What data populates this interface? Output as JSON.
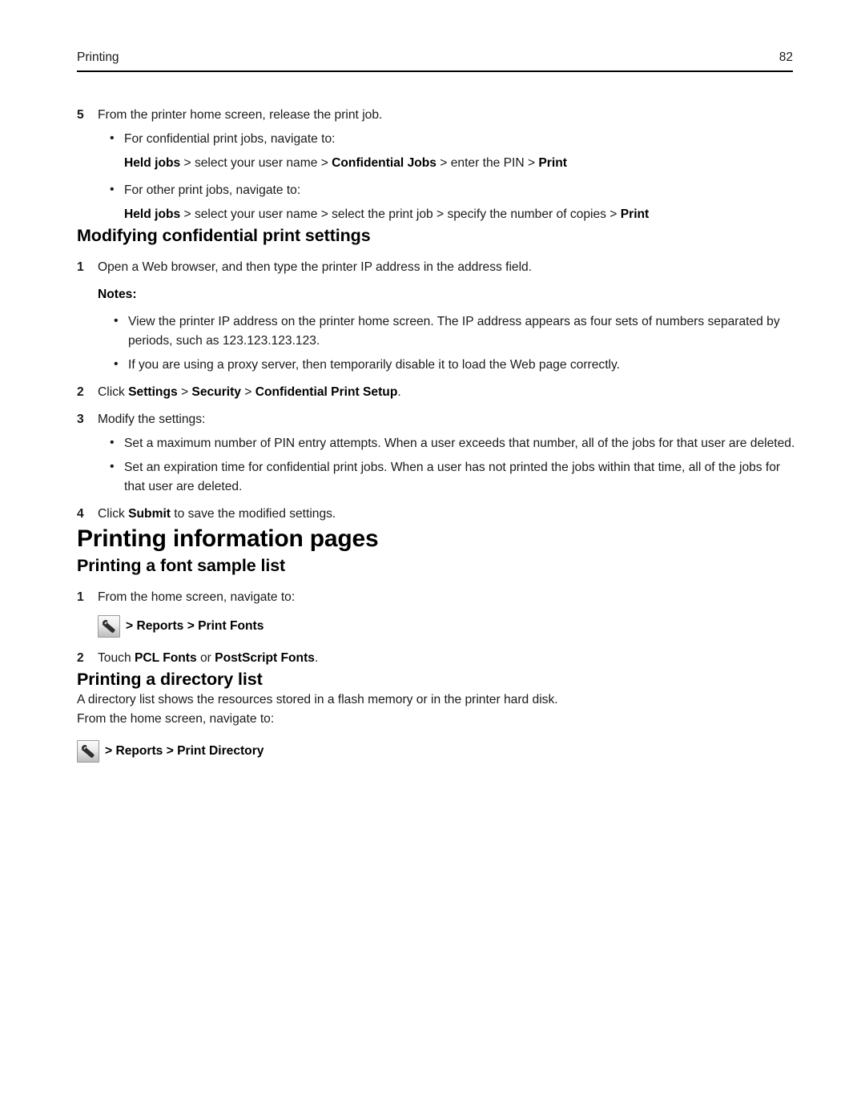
{
  "header": {
    "running_title": "Printing",
    "page_number": "82"
  },
  "step5": {
    "num": "5",
    "text": "From the printer home screen, release the print job.",
    "bullets": [
      {
        "lead": "For confidential print jobs, navigate to:",
        "path": [
          {
            "t": "Held jobs",
            "b": true
          },
          {
            "t": " > select your user name > ",
            "b": false
          },
          {
            "t": "Confidential Jobs",
            "b": true
          },
          {
            "t": " > enter the PIN > ",
            "b": false
          },
          {
            "t": "Print",
            "b": true
          }
        ]
      },
      {
        "lead": "For other print jobs, navigate to:",
        "path": [
          {
            "t": "Held jobs",
            "b": true
          },
          {
            "t": " > select your user name > select the print job > specify the number of copies > ",
            "b": false
          },
          {
            "t": "Print",
            "b": true
          }
        ]
      }
    ]
  },
  "section_modify": {
    "heading": "Modifying confidential print settings",
    "step1": {
      "num": "1",
      "text": "Open a Web browser, and then type the printer IP address in the address field."
    },
    "notes_label": "Notes:",
    "notes": [
      "View the printer IP address on the printer home screen. The IP address appears as four sets of numbers separated by periods, such as 123.123.123.123.",
      "If you are using a proxy server, then temporarily disable it to load the Web page correctly."
    ],
    "step2": {
      "num": "2",
      "parts": [
        {
          "t": "Click ",
          "b": false
        },
        {
          "t": "Settings",
          "b": true
        },
        {
          "t": " > ",
          "b": false
        },
        {
          "t": "Security",
          "b": true
        },
        {
          "t": " > ",
          "b": false
        },
        {
          "t": "Confidential Print Setup",
          "b": true
        },
        {
          "t": ".",
          "b": false
        }
      ]
    },
    "step3": {
      "num": "3",
      "text": "Modify the settings:",
      "bullets": [
        "Set a maximum number of PIN entry attempts. When a user exceeds that number, all of the jobs for that user are deleted.",
        "Set an expiration time for confidential print jobs. When a user has not printed the jobs within that time, all of the jobs for that user are deleted."
      ]
    },
    "step4": {
      "num": "4",
      "parts": [
        {
          "t": "Click ",
          "b": false
        },
        {
          "t": "Submit",
          "b": true
        },
        {
          "t": " to save the modified settings.",
          "b": false
        }
      ]
    }
  },
  "section_info_pages": {
    "heading": "Printing information pages"
  },
  "section_font_sample": {
    "heading": "Printing a font sample list",
    "step1": {
      "num": "1",
      "text": "From the home screen, navigate to:"
    },
    "nav_icon": "wrench-icon",
    "nav_path": "> Reports > Print Fonts",
    "step2": {
      "num": "2",
      "parts": [
        {
          "t": "Touch ",
          "b": false
        },
        {
          "t": "PCL Fonts",
          "b": true
        },
        {
          "t": " or ",
          "b": false
        },
        {
          "t": "PostScript Fonts",
          "b": true
        },
        {
          "t": ".",
          "b": false
        }
      ]
    }
  },
  "section_directory": {
    "heading": "Printing a directory list",
    "intro": "A directory list shows the resources stored in a flash memory or in the printer hard disk.",
    "lead": "From the home screen, navigate to:",
    "nav_icon": "wrench-icon",
    "nav_path": "> Reports > Print Directory"
  },
  "glyphs": {
    "bullet": "•"
  }
}
